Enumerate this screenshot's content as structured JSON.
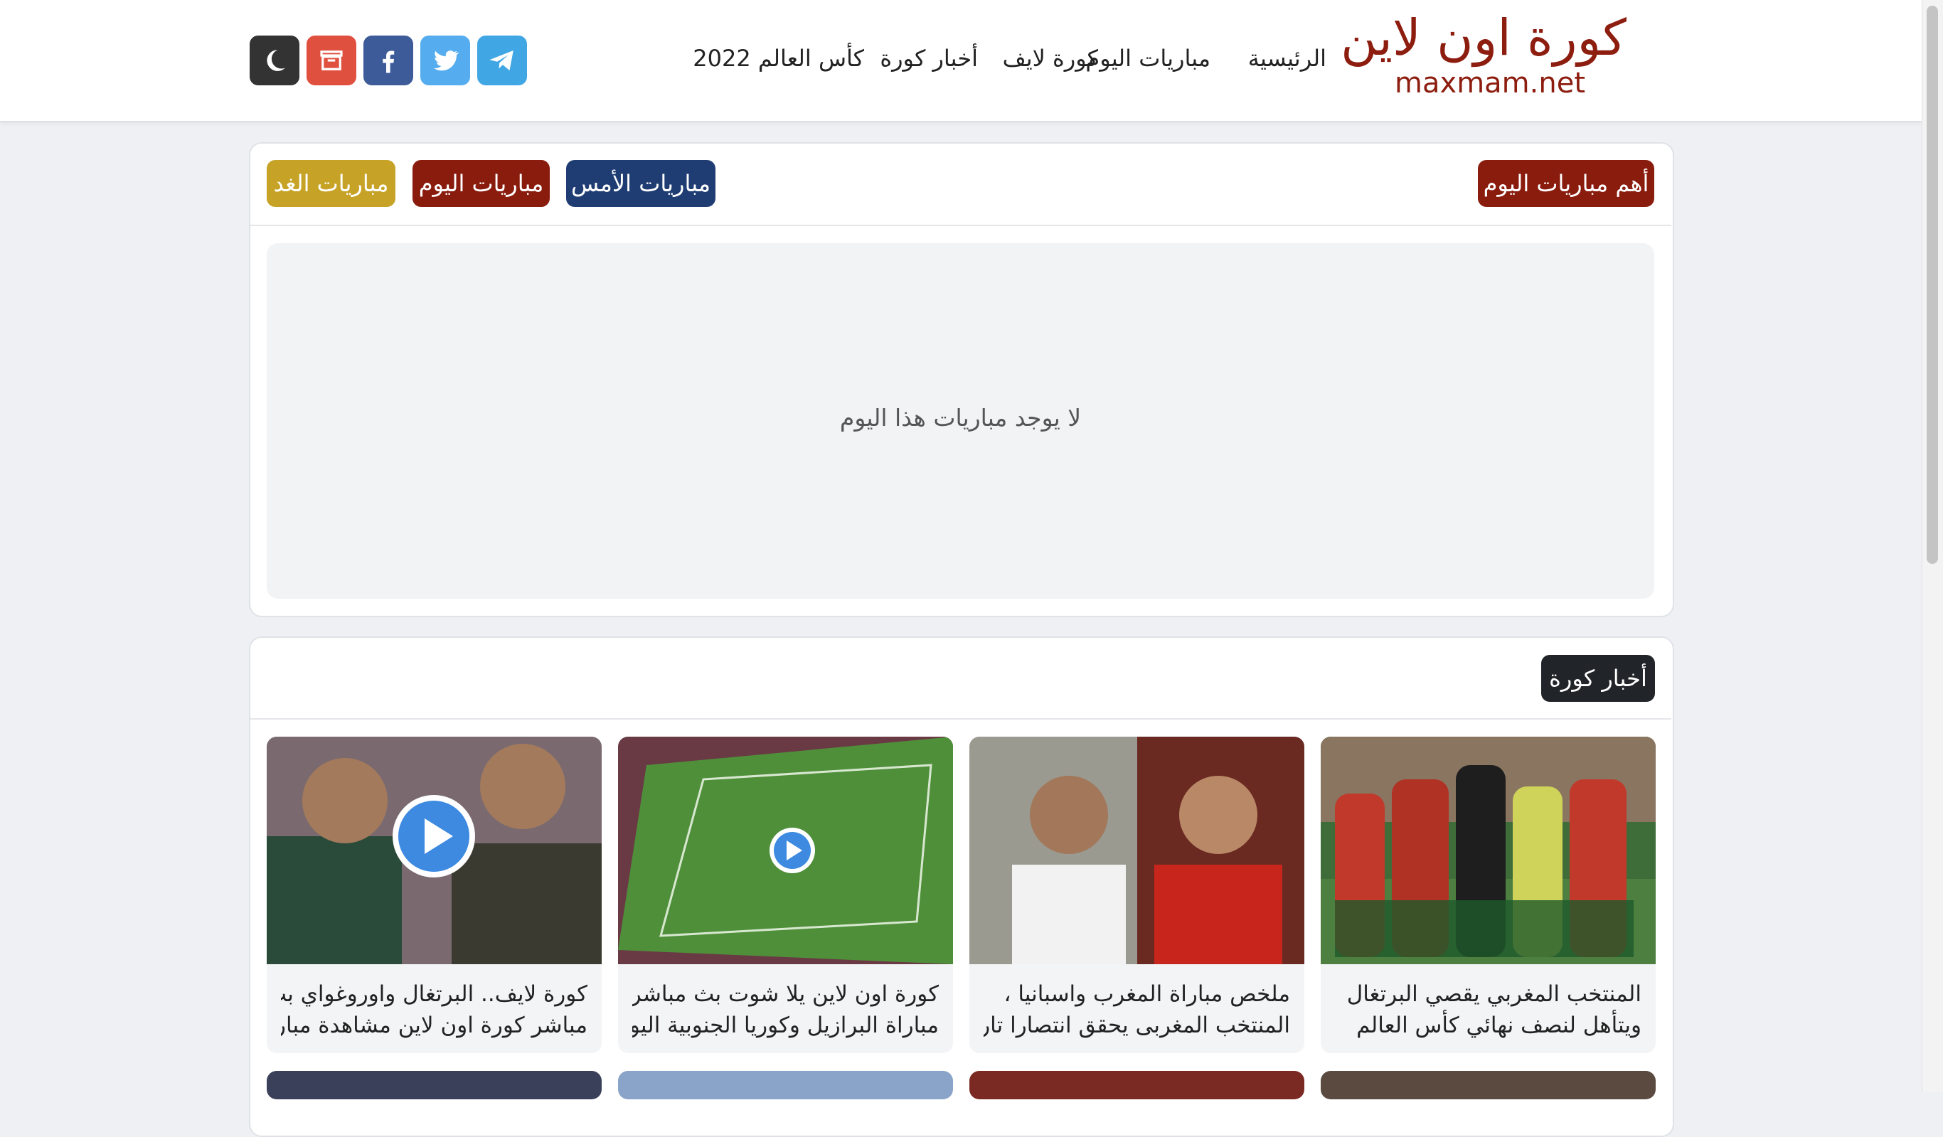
{
  "site": {
    "title": "كورة اون لاين",
    "domain": "maxmam.net"
  },
  "nav": {
    "items": [
      "الرئيسية",
      "مباريات اليوم",
      "كورة لايف",
      "أخبار كورة",
      "كأس العالم 2022"
    ]
  },
  "social_icons": [
    "telegram-icon",
    "twitter-icon",
    "facebook-icon",
    "store-icon",
    "moon-icon"
  ],
  "colors": {
    "brand": "#8c1d0f",
    "telegram": "#41a6e4",
    "twitter": "#55acee",
    "facebook": "#3d5b99",
    "store": "#e0503f",
    "dark_mode": "#333333",
    "yesterday": "#1f3d73",
    "today": "#8a1c0e",
    "tomorrow": "#c6a327",
    "news_heading": "#212529"
  },
  "matches": {
    "heading": "أهم مباريات اليوم",
    "tabs": {
      "yesterday": "مباريات الأمس",
      "today": "مباريات اليوم",
      "tomorrow": "مباريات الغد"
    },
    "empty_message": "لا يوجد مباريات هذا اليوم"
  },
  "news": {
    "heading": "أخبار كورة",
    "items": [
      {
        "line1": "المنتخب المغربي يقصي البرتغال",
        "line2": "ويتأهل لنصف نهائي كأس العالم"
      },
      {
        "line1": "ملخص مباراة المغرب واسبانيا ،",
        "line2": "المنتخب المغربى يحقق انتصارا تاريخيا"
      },
      {
        "line1": "كورة اون لاين يلا شوت بث مباشر",
        "line2": "مباراة البرازيل وكوريا الجنوبية اليوم"
      },
      {
        "line1": "كورة لايف.. البرتغال واوروغواي بث",
        "line2": "مباشر كورة اون لاين مشاهدة مباراة"
      }
    ]
  }
}
